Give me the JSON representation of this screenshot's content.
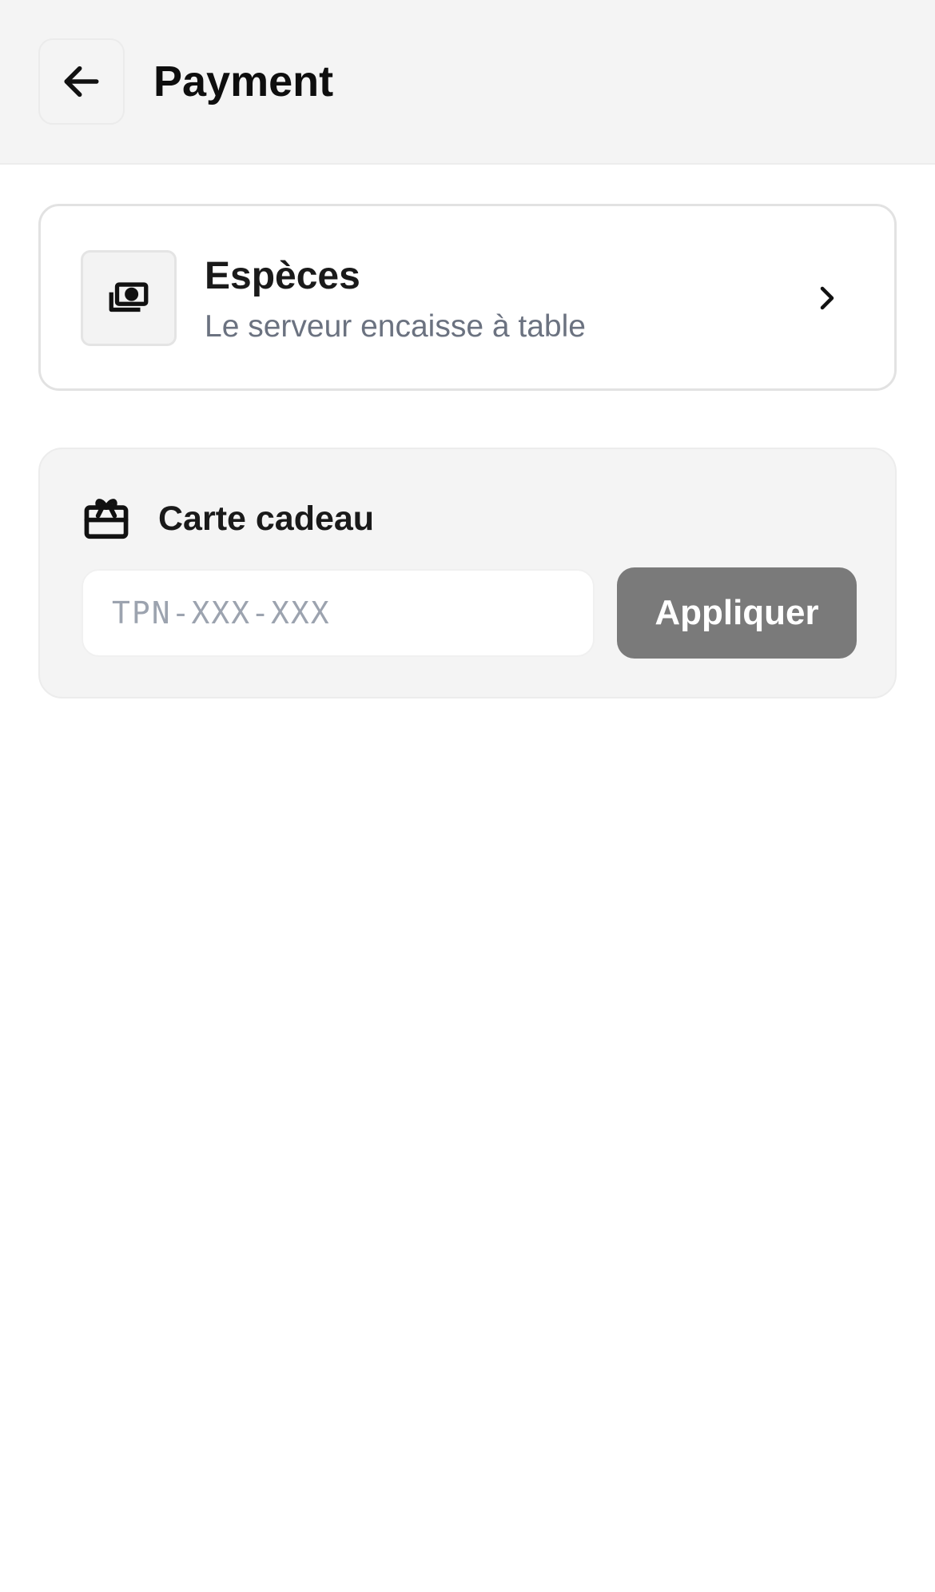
{
  "header": {
    "title": "Payment",
    "back_icon": "arrow-left-icon"
  },
  "payment_method": {
    "title": "Espèces",
    "subtitle": "Le serveur encaisse à table",
    "icon": "cash-icon",
    "chevron_icon": "chevron-right-icon"
  },
  "gift_card": {
    "title": "Carte cadeau",
    "icon": "gift-card-icon",
    "input_value": "",
    "input_placeholder": "TPN-XXX-XXX",
    "apply_label": "Appliquer",
    "apply_button_color": "#7a7a7a"
  }
}
